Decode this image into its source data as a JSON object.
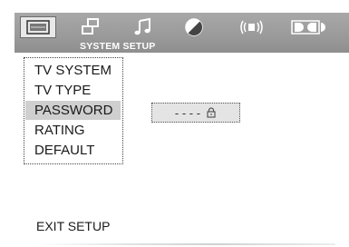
{
  "header": {
    "subtitle": "SYSTEM SETUP",
    "tabs": [
      {
        "icon": "monitor-icon",
        "active": true
      },
      {
        "icon": "speaker-notes-icon",
        "active": false
      },
      {
        "icon": "music-note-icon",
        "active": false
      },
      {
        "icon": "color-circle-icon",
        "active": false
      },
      {
        "icon": "sound-wave-icon",
        "active": false
      },
      {
        "icon": "dolby-icon",
        "active": false
      }
    ]
  },
  "menu": {
    "items": [
      "TV SYSTEM",
      "TV TYPE",
      "PASSWORD",
      "RATING",
      "DEFAULT"
    ],
    "selected": "PASSWORD"
  },
  "password_field": {
    "value": "- - - -",
    "icon": "lock-icon"
  },
  "exit_label": "EXIT SETUP",
  "colors": {
    "header_bar": "#9a9a9a",
    "selection": "#cfcfcf",
    "active_tab": "#e8e8e8"
  }
}
